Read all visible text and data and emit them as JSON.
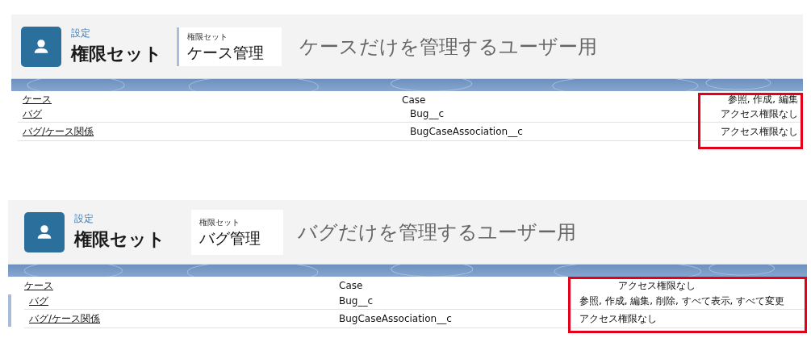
{
  "panels": [
    {
      "breadcrumb": "設定",
      "page_title": "権限セット",
      "record_type": "権限セット",
      "record_name": "ケース管理",
      "description": "ケースだけを管理するユーザー用",
      "permissions_highlighted": true,
      "rows": [
        {
          "object": "ケース",
          "api_name": "Case",
          "access": "参照, 作成, 編集"
        },
        {
          "object": "バグ",
          "api_name": "Bug__c",
          "access": "アクセス権限なし"
        },
        {
          "object": "バグ/ケース関係",
          "api_name": "BugCaseAssociation__c",
          "access": "アクセス権限なし"
        }
      ]
    },
    {
      "breadcrumb": "設定",
      "page_title": "権限セット",
      "record_type": "権限セット",
      "record_name": "バグ管理",
      "description": "バグだけを管理するユーザー用",
      "permissions_highlighted": true,
      "rows": [
        {
          "object": "ケース",
          "api_name": "Case",
          "access": "アクセス権限なし"
        },
        {
          "object": "バグ",
          "api_name": "Bug__c",
          "access": "参照, 作成, 編集, 削除, すべて表示, すべて変更"
        },
        {
          "object": "バグ/ケース関係",
          "api_name": "BugCaseAssociation__c",
          "access": "アクセス権限なし"
        }
      ]
    }
  ]
}
